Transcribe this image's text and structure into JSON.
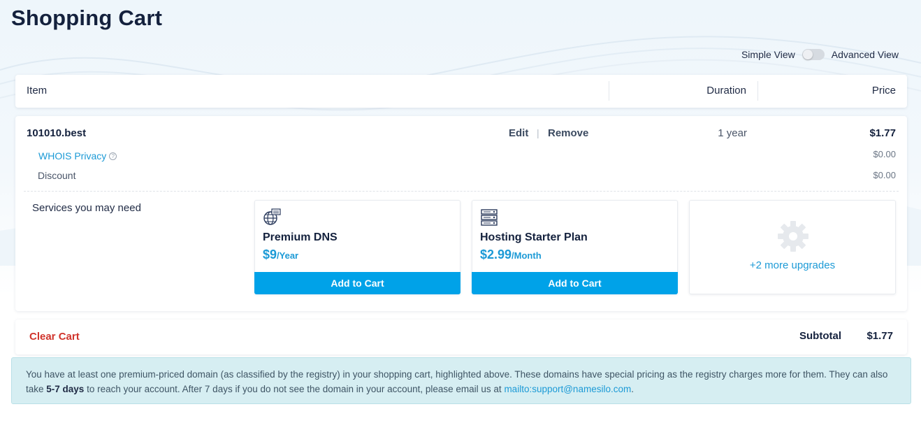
{
  "page": {
    "title": "Shopping Cart"
  },
  "view_toggle": {
    "simple_label": "Simple View",
    "advanced_label": "Advanced View",
    "advanced_on": false
  },
  "table_header": {
    "item": "Item",
    "duration": "Duration",
    "price": "Price"
  },
  "cart_item": {
    "domain": "101010.best",
    "edit_label": "Edit",
    "separator": "|",
    "remove_label": "Remove",
    "duration": "1 year",
    "price": "$1.77",
    "whois_label": "WHOIS Privacy",
    "whois_price": "$0.00",
    "discount_label": "Discount",
    "discount_price": "$0.00"
  },
  "services": {
    "label": "Services you may need",
    "cards": [
      {
        "icon": "globe-dns-icon",
        "title": "Premium DNS",
        "price": "$9",
        "period": "/Year",
        "button": "Add to Cart"
      },
      {
        "icon": "server-icon",
        "title": "Hosting Starter Plan",
        "price": "$2.99",
        "period": "/Month",
        "button": "Add to Cart"
      }
    ],
    "more": {
      "icon": "gear-icon",
      "label": "+2 more upgrades"
    }
  },
  "footer": {
    "clear_cart": "Clear Cart",
    "subtotal_label": "Subtotal",
    "subtotal_value": "$1.77"
  },
  "notice": {
    "text_before": "You have at least one premium-priced domain (as classified by the registry) in your shopping cart, highlighted above. These domains have special pricing as the registry charges more for them. They can also take ",
    "bold": "5-7 days",
    "text_after": " to reach your account. After 7 days if you do not see the domain in your account, please email us at ",
    "email": "mailto:support@namesilo.com",
    "end": "."
  },
  "colors": {
    "accent": "#00a2e8",
    "link": "#1c9ad6",
    "danger": "#d0342c",
    "notice_bg": "#d6eef2",
    "title": "#14213d"
  }
}
